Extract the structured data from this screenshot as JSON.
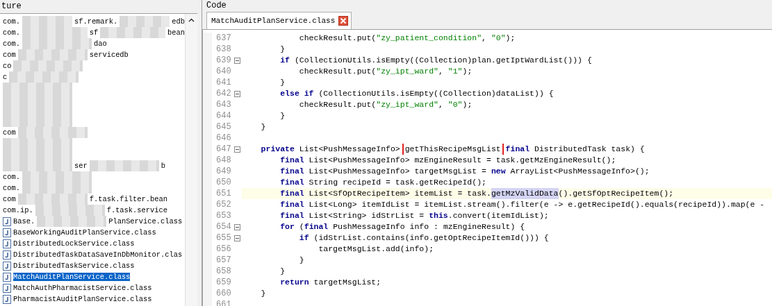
{
  "structure_panel": {
    "title": "ture",
    "packages": [
      {
        "parts": [
          {
            "kind": "text",
            "text": "com."
          },
          {
            "kind": "mosaic"
          },
          {
            "kind": "text",
            "text": "sf.remark."
          },
          {
            "kind": "mosaic"
          },
          {
            "kind": "text",
            "text": "edb"
          }
        ]
      },
      {
        "parts": [
          {
            "kind": "text",
            "text": "com."
          },
          {
            "kind": "mosaic"
          },
          {
            "kind": "text",
            "text": "sf"
          },
          {
            "kind": "mosaic"
          },
          {
            "kind": "text",
            "text": "bean"
          }
        ]
      },
      {
        "parts": [
          {
            "kind": "text",
            "text": "com."
          },
          {
            "kind": "mosaic"
          },
          {
            "kind": "text",
            "text": "dao"
          }
        ]
      },
      {
        "parts": [
          {
            "kind": "text",
            "text": "com"
          },
          {
            "kind": "mosaic"
          },
          {
            "kind": "text",
            "text": "servicedb"
          }
        ]
      },
      {
        "parts": [
          {
            "kind": "text",
            "text": "co"
          },
          {
            "kind": "mosaic"
          }
        ]
      },
      {
        "parts": [
          {
            "kind": "text",
            "text": "c"
          },
          {
            "kind": "mosaic"
          }
        ]
      },
      {
        "parts": [
          {
            "kind": "mosaic"
          }
        ]
      },
      {
        "parts": [
          {
            "kind": "mosaic"
          }
        ]
      },
      {
        "parts": [
          {
            "kind": "mosaic"
          }
        ]
      },
      {
        "parts": [
          {
            "kind": "mosaic"
          }
        ]
      },
      {
        "parts": [
          {
            "kind": "text",
            "text": "com"
          },
          {
            "kind": "mosaic"
          }
        ]
      },
      {
        "parts": [
          {
            "kind": "mosaic"
          }
        ]
      },
      {
        "parts": [
          {
            "kind": "mosaic"
          }
        ]
      },
      {
        "parts": [
          {
            "kind": "mosaic"
          },
          {
            "kind": "text",
            "text": "ser"
          },
          {
            "kind": "mosaic"
          },
          {
            "kind": "text",
            "text": "b"
          }
        ]
      },
      {
        "parts": [
          {
            "kind": "text",
            "text": "com."
          },
          {
            "kind": "mosaic"
          }
        ]
      },
      {
        "parts": [
          {
            "kind": "text",
            "text": "com."
          },
          {
            "kind": "mosaic"
          }
        ]
      },
      {
        "parts": [
          {
            "kind": "text",
            "text": "com"
          },
          {
            "kind": "mosaic"
          },
          {
            "kind": "text",
            "text": "f.task.filter.bean"
          }
        ]
      },
      {
        "parts": [
          {
            "kind": "text",
            "text": "com.ip."
          },
          {
            "kind": "mosaic"
          },
          {
            "kind": "text",
            "text": "f.task.service"
          }
        ]
      }
    ],
    "classes": [
      {
        "parts": [
          {
            "kind": "text",
            "text": "Base."
          },
          {
            "kind": "mosaic"
          },
          {
            "kind": "text",
            "text": "PlanService.class"
          }
        ],
        "selected": false
      },
      {
        "parts": [
          {
            "kind": "text",
            "text": "BaseWorkingAuditPlanService.class"
          }
        ],
        "selected": false
      },
      {
        "parts": [
          {
            "kind": "text",
            "text": "DistributedLockService.class"
          }
        ],
        "selected": false
      },
      {
        "parts": [
          {
            "kind": "text",
            "text": "DistributedTaskDataSaveInDbMonitor.clas"
          }
        ],
        "selected": false
      },
      {
        "parts": [
          {
            "kind": "text",
            "text": "DistributedTaskService.class"
          }
        ],
        "selected": false
      },
      {
        "parts": [
          {
            "kind": "text",
            "text": "MatchAuditPlanService.class"
          }
        ],
        "selected": true
      },
      {
        "parts": [
          {
            "kind": "text",
            "text": "MatchAuthPharmacistService.class"
          }
        ],
        "selected": false
      },
      {
        "parts": [
          {
            "kind": "text",
            "text": "PharmacistAuditPlanService.class"
          }
        ],
        "selected": false
      }
    ]
  },
  "code_panel": {
    "title": "Code",
    "tabs": [
      {
        "label": "MatchAuditPlanService.class",
        "selected": true
      }
    ],
    "lines": [
      {
        "number": "637",
        "foldable": false,
        "current": false,
        "tokens": [
          {
            "kind": "plain",
            "text": "            checkResult.put("
          },
          {
            "kind": "string",
            "text": "\"zy_patient_condition\""
          },
          {
            "kind": "plain",
            "text": ", "
          },
          {
            "kind": "string",
            "text": "\"0\""
          },
          {
            "kind": "plain",
            "text": ");"
          }
        ]
      },
      {
        "number": "638",
        "foldable": false,
        "current": false,
        "tokens": [
          {
            "kind": "plain",
            "text": "        }"
          }
        ]
      },
      {
        "number": "639",
        "foldable": true,
        "current": false,
        "tokens": [
          {
            "kind": "keyword",
            "text": "        if"
          },
          {
            "kind": "plain",
            "text": " (CollectionUtils.isEmpty((Collection)plan.getIptWardList())) {"
          }
        ]
      },
      {
        "number": "640",
        "foldable": false,
        "current": false,
        "tokens": [
          {
            "kind": "plain",
            "text": "            checkResult.put("
          },
          {
            "kind": "string",
            "text": "\"zy_ipt_ward\""
          },
          {
            "kind": "plain",
            "text": ", "
          },
          {
            "kind": "string",
            "text": "\"1\""
          },
          {
            "kind": "plain",
            "text": ");"
          }
        ]
      },
      {
        "number": "641",
        "foldable": false,
        "current": false,
        "tokens": [
          {
            "kind": "plain",
            "text": "        }"
          }
        ]
      },
      {
        "number": "642",
        "foldable": true,
        "current": false,
        "tokens": [
          {
            "kind": "keyword",
            "text": "        else if"
          },
          {
            "kind": "plain",
            "text": " (CollectionUtils.isEmpty((Collection)dataList)) {"
          }
        ]
      },
      {
        "number": "643",
        "foldable": false,
        "current": false,
        "tokens": [
          {
            "kind": "plain",
            "text": "            checkResult.put("
          },
          {
            "kind": "string",
            "text": "\"zy_ipt_ward\""
          },
          {
            "kind": "plain",
            "text": ", "
          },
          {
            "kind": "string",
            "text": "\"0\""
          },
          {
            "kind": "plain",
            "text": ");"
          }
        ]
      },
      {
        "number": "644",
        "foldable": false,
        "current": false,
        "tokens": [
          {
            "kind": "plain",
            "text": "        }"
          }
        ]
      },
      {
        "number": "645",
        "foldable": false,
        "current": false,
        "tokens": [
          {
            "kind": "plain",
            "text": "    }"
          }
        ]
      },
      {
        "number": "646",
        "foldable": false,
        "current": false
      },
      {
        "number": "647",
        "foldable": true,
        "current": false,
        "tokens": [
          {
            "kind": "keyword",
            "text": "    private"
          },
          {
            "kind": "plain",
            "text": " List<PushMessageInfo> "
          },
          {
            "kind": "boxed",
            "text": "getThisRecipeMsgList"
          },
          {
            "kind": "keyword",
            "text": " final"
          },
          {
            "kind": "plain",
            "text": " DistributedTask task) {"
          }
        ]
      },
      {
        "number": "648",
        "foldable": false,
        "current": false,
        "tokens": [
          {
            "kind": "keyword",
            "text": "        final"
          },
          {
            "kind": "plain",
            "text": " List<PushMessageInfo> mzEngineResult = task.getMzEngineResult();"
          }
        ]
      },
      {
        "number": "649",
        "foldable": false,
        "current": false,
        "tokens": [
          {
            "kind": "keyword",
            "text": "        final"
          },
          {
            "kind": "plain",
            "text": " List<PushMessageInfo> targetMsgList = "
          },
          {
            "kind": "keyword",
            "text": "new"
          },
          {
            "kind": "plain",
            "text": " ArrayList<PushMessageInfo>();"
          }
        ]
      },
      {
        "number": "650",
        "foldable": false,
        "current": false,
        "tokens": [
          {
            "kind": "keyword",
            "text": "        final"
          },
          {
            "kind": "plain",
            "text": " String recipeId = task.getRecipeId();"
          }
        ]
      },
      {
        "number": "651",
        "foldable": false,
        "current": true,
        "tokens": [
          {
            "kind": "keyword",
            "text": "        final"
          },
          {
            "kind": "plain",
            "text": " List<SfOptRecipeItem> itemList = task."
          },
          {
            "kind": "marked",
            "text": "getMzValidData"
          },
          {
            "kind": "plain",
            "text": "().getSfOptRecipeItem();"
          }
        ]
      },
      {
        "number": "652",
        "foldable": false,
        "current": false,
        "tokens": [
          {
            "kind": "keyword",
            "text": "        final"
          },
          {
            "kind": "plain",
            "text": " List<Long> itemIdList = itemList.stream().filter(e -> e.getRecipeId().equals(recipeId)).map(e -"
          }
        ]
      },
      {
        "number": "653",
        "foldable": false,
        "current": false,
        "tokens": [
          {
            "kind": "keyword",
            "text": "        final"
          },
          {
            "kind": "plain",
            "text": " List<String> idStrList = "
          },
          {
            "kind": "keyword",
            "text": "this"
          },
          {
            "kind": "plain",
            "text": ".convert(itemIdList);"
          }
        ]
      },
      {
        "number": "654",
        "foldable": true,
        "current": false,
        "tokens": [
          {
            "kind": "keyword",
            "text": "        for"
          },
          {
            "kind": "plain",
            "text": " ("
          },
          {
            "kind": "keyword",
            "text": "final"
          },
          {
            "kind": "plain",
            "text": " PushMessageInfo info : mzEngineResult) {"
          }
        ]
      },
      {
        "number": "655",
        "foldable": true,
        "current": false,
        "tokens": [
          {
            "kind": "keyword",
            "text": "            if"
          },
          {
            "kind": "plain",
            "text": " (idStrList.contains(info.getOptRecipeItemId())) {"
          }
        ]
      },
      {
        "number": "656",
        "foldable": false,
        "current": false,
        "tokens": [
          {
            "kind": "plain",
            "text": "                targetMsgList.add(info);"
          }
        ]
      },
      {
        "number": "657",
        "foldable": false,
        "current": false,
        "tokens": [
          {
            "kind": "plain",
            "text": "            }"
          }
        ]
      },
      {
        "number": "658",
        "foldable": false,
        "current": false,
        "tokens": [
          {
            "kind": "plain",
            "text": "        }"
          }
        ]
      },
      {
        "number": "659",
        "foldable": false,
        "current": false,
        "tokens": [
          {
            "kind": "keyword",
            "text": "        return"
          },
          {
            "kind": "plain",
            "text": " targetMsgList;"
          }
        ]
      },
      {
        "number": "660",
        "foldable": false,
        "current": false,
        "tokens": [
          {
            "kind": "plain",
            "text": "    }"
          }
        ]
      },
      {
        "number": "661",
        "foldable": false,
        "current": false
      }
    ]
  }
}
